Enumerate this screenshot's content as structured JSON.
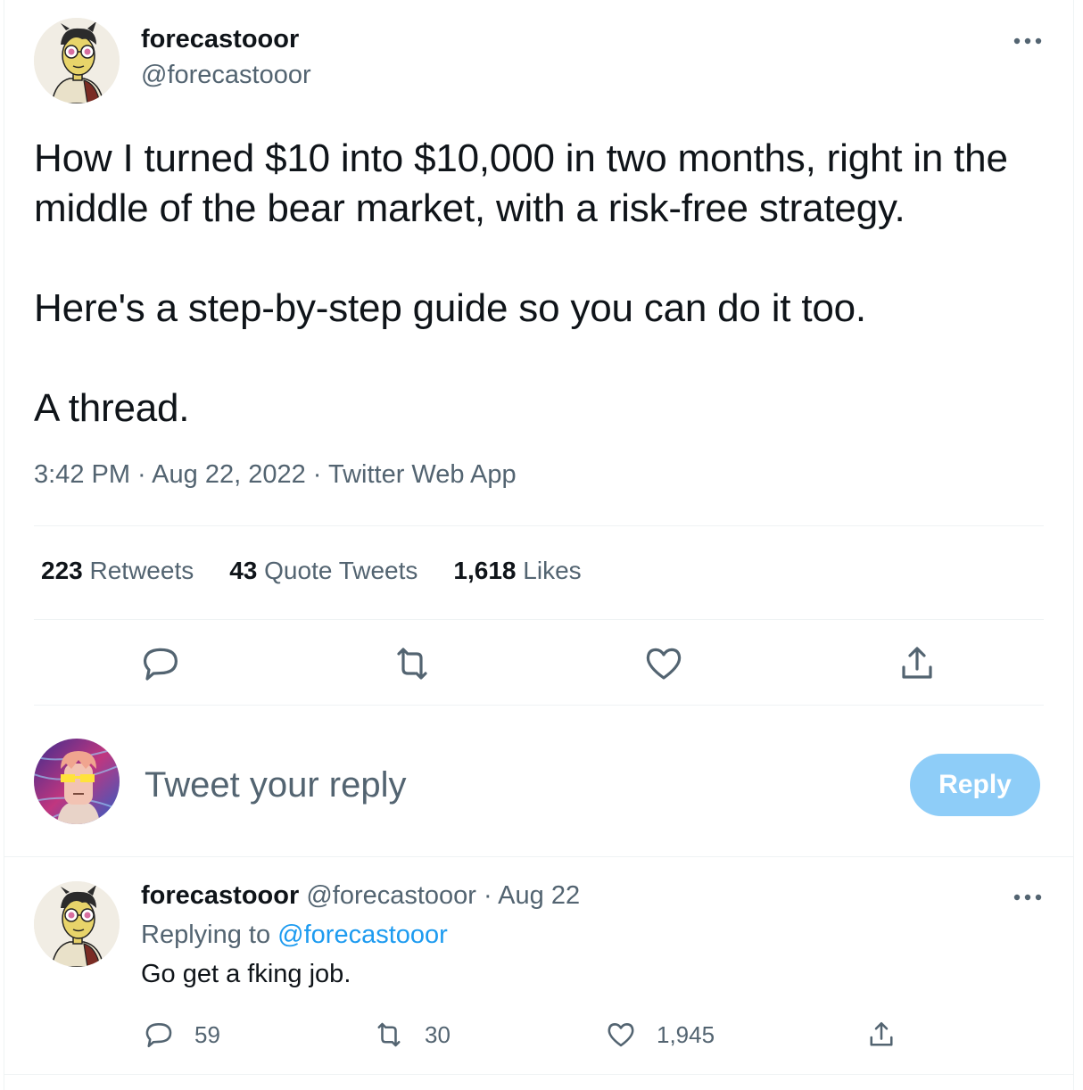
{
  "main_tweet": {
    "display_name": "forecastooor",
    "handle": "@forecastooor",
    "paragraphs": [
      "How I turned $10 into $10,000 in two months, right in the middle of the bear market, with a risk-free strategy.",
      "Here's a step-by-step guide so you can do it too.",
      "A thread."
    ],
    "time": "3:42 PM",
    "date": "Aug 22, 2022",
    "source": "Twitter Web App",
    "meta_separator": " · ",
    "stats": {
      "retweets_count": "223",
      "retweets_label": "Retweets",
      "quotes_count": "43",
      "quotes_label": "Quote Tweets",
      "likes_count": "1,618",
      "likes_label": "Likes"
    },
    "actions": [
      "reply-icon",
      "retweet-icon",
      "like-icon",
      "share-icon"
    ]
  },
  "compose": {
    "placeholder": "Tweet your reply",
    "button_label": "Reply",
    "button_color": "#8ecdf8"
  },
  "reply_tweet": {
    "display_name": "forecastooor",
    "handle": "@forecastooor",
    "date": "Aug 22",
    "dot": "·",
    "replying_prefix": "Replying to",
    "replying_handle": "@forecastooor",
    "text": "Go get a fking job.",
    "reply_count": "59",
    "retweet_count": "30",
    "like_count": "1,945"
  },
  "colors": {
    "text": "#0f1419",
    "muted": "#536471",
    "link": "#1d9bf0",
    "divider": "#eff3f4"
  }
}
